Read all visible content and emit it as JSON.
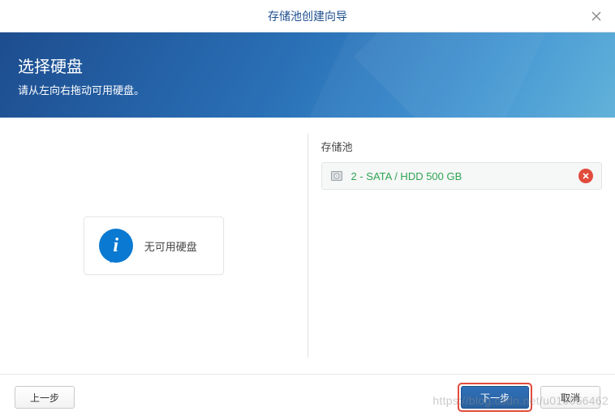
{
  "titlebar": {
    "title": "存储池创建向导"
  },
  "banner": {
    "title": "选择硬盘",
    "subtitle": "请从左向右拖动可用硬盘。"
  },
  "left": {
    "info_glyph": "i",
    "no_drive_text": "无可用硬盘"
  },
  "right": {
    "pool_title": "存储池",
    "drives": [
      {
        "label": "2 - SATA / HDD 500 GB"
      }
    ]
  },
  "footer": {
    "prev": "上一步",
    "next": "下一步",
    "cancel": "取消"
  },
  "watermark": "https://blog.csdn.net/u010056462"
}
